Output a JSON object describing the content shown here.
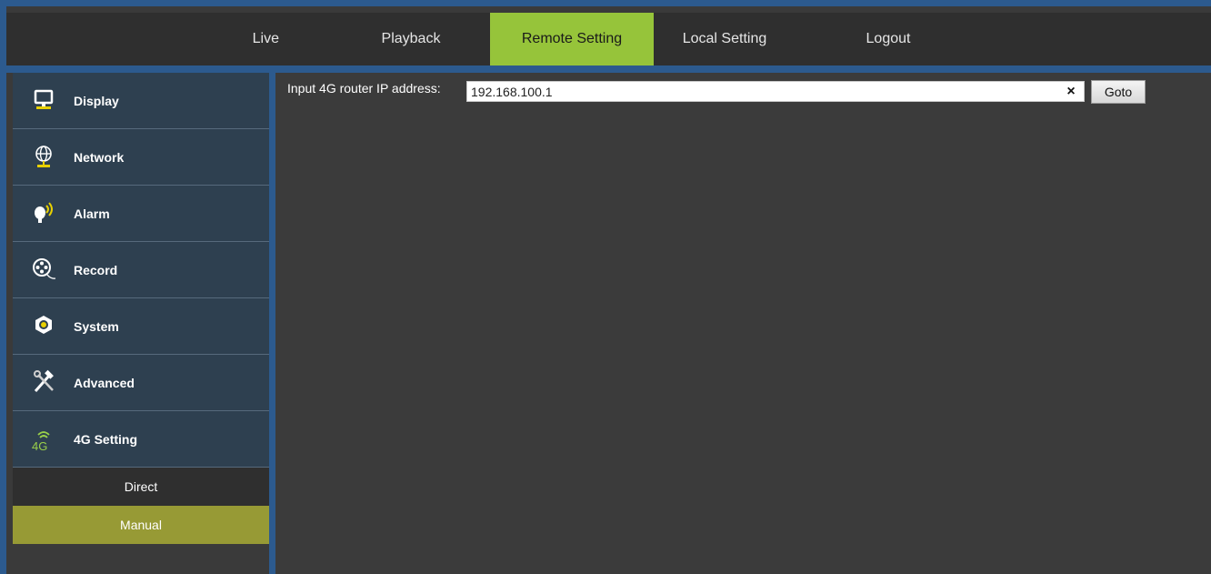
{
  "nav": {
    "live": "Live",
    "playback": "Playback",
    "remote_setting": "Remote Setting",
    "local_setting": "Local Setting",
    "logout": "Logout"
  },
  "sidebar": {
    "items": [
      {
        "label": "Display",
        "icon": "monitor-icon"
      },
      {
        "label": "Network",
        "icon": "globe-icon"
      },
      {
        "label": "Alarm",
        "icon": "alarm-bulb-icon"
      },
      {
        "label": "Record",
        "icon": "film-reel-icon"
      },
      {
        "label": "System",
        "icon": "hex-nut-icon"
      },
      {
        "label": "Advanced",
        "icon": "tools-icon"
      },
      {
        "label": "4G Setting",
        "icon": "4g-signal-icon"
      }
    ],
    "sub_items": [
      {
        "label": "Direct",
        "active": false
      },
      {
        "label": "Manual",
        "active": true
      }
    ]
  },
  "main": {
    "ip_label": "Input 4G router IP address:",
    "ip_value": "192.168.100.1",
    "clear_symbol": "×",
    "goto_label": "Goto"
  },
  "colors": {
    "active_tab": "#96c43a",
    "active_subitem": "#979a35",
    "frame_blue": "#2c5a8e",
    "sidebar_item_bg": "#2e4050"
  }
}
